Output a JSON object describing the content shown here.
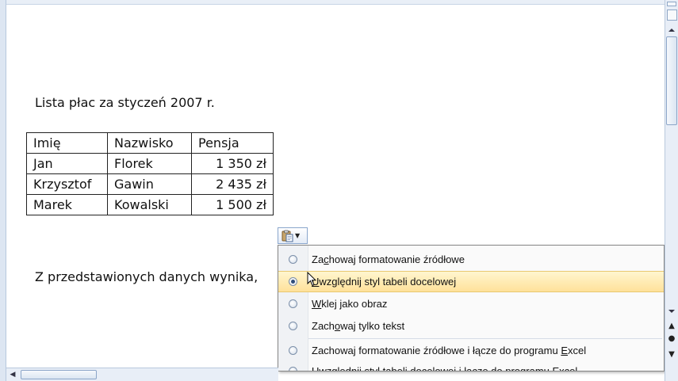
{
  "document": {
    "heading": "Lista płac za styczeń 2007 r.",
    "table": {
      "headers": [
        "Imię",
        "Nazwisko",
        "Pensja"
      ],
      "rows": [
        [
          "Jan",
          "Florek",
          "1 350 zł"
        ],
        [
          "Krzysztof",
          "Gawin",
          "2 435 zł"
        ],
        [
          "Marek",
          "Kowalski",
          "1 500 zł"
        ]
      ]
    },
    "paragraph": "Z przedstawionych danych wynika,"
  },
  "paste_options": {
    "button_icon": "clipboard-icon",
    "items": [
      {
        "pre": "Za",
        "key": "c",
        "post": "howaj formatowanie źródłowe",
        "selected": false
      },
      {
        "pre": "",
        "key": "U",
        "post": "względnij styl tabeli docelowej",
        "selected": true
      },
      {
        "pre": "",
        "key": "W",
        "post": "klej jako obraz",
        "selected": false
      },
      {
        "pre": "Zach",
        "key": "o",
        "post": "waj tylko tekst",
        "selected": false
      },
      {
        "pre": "Zachowaj formatowanie źródłowe i łącze do programu ",
        "key": "E",
        "post": "xcel",
        "selected": false
      },
      {
        "pre": "Uwzględnij styl tabeli docelowej i łą",
        "key": "c",
        "post": "ze do programu Excel",
        "selected": false
      }
    ]
  },
  "colors": {
    "hover_highlight": "#ffe19a",
    "scrollbar": "#e8eef7"
  }
}
